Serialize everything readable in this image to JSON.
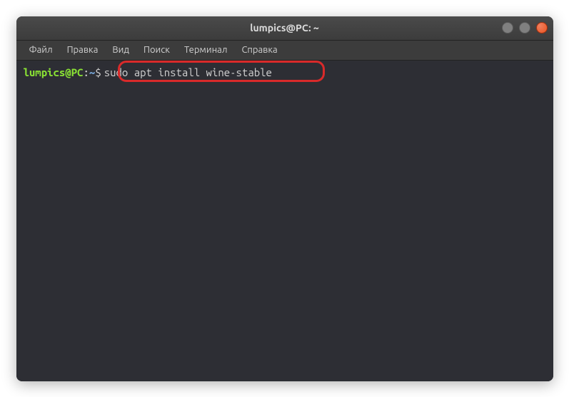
{
  "window": {
    "title": "lumpics@PC: ~"
  },
  "menubar": {
    "items": [
      "Файл",
      "Правка",
      "Вид",
      "Поиск",
      "Терминал",
      "Справка"
    ]
  },
  "terminal": {
    "prompt_user": "lumpics@PC",
    "prompt_colon": ":",
    "prompt_path": "~",
    "prompt_symbol": "$",
    "command": "sudo apt install wine-stable"
  }
}
